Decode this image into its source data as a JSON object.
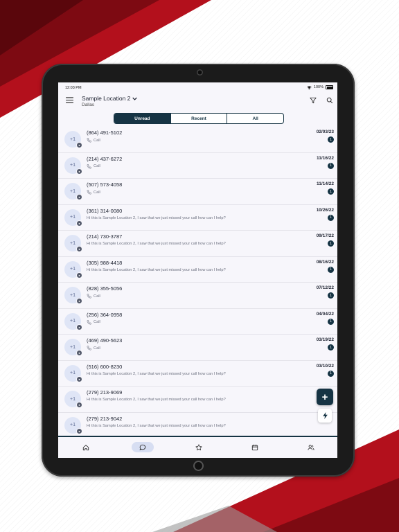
{
  "colors": {
    "accent": "#163444",
    "avatar_bg": "#dfe5f6",
    "backdrop_red": "#a90f1c"
  },
  "status_bar": {
    "time": "12:03 PM",
    "battery": "100%",
    "icons": [
      "wifi-icon",
      "battery-icon"
    ]
  },
  "header": {
    "location_name": "Sample Location 2",
    "location_city": "Dallas",
    "icons": [
      "menu-icon",
      "chevron-down-icon",
      "filter-icon",
      "search-icon"
    ]
  },
  "tabs": [
    {
      "label": "Unread",
      "active": true
    },
    {
      "label": "Recent",
      "active": false
    },
    {
      "label": "All",
      "active": false
    }
  ],
  "conversations": [
    {
      "avatar": "+1",
      "phone": "(864) 491-5102",
      "preview": "Call",
      "type": "call",
      "date": "02/03/23",
      "unread": "1"
    },
    {
      "avatar": "+1",
      "phone": "(214) 437-6272",
      "preview": "Call",
      "type": "call",
      "date": "11/16/22",
      "unread": "1"
    },
    {
      "avatar": "+1",
      "phone": "(507) 573-4058",
      "preview": "Call",
      "type": "call",
      "date": "11/14/22",
      "unread": "1"
    },
    {
      "avatar": "+1",
      "phone": "(361) 314-0080",
      "preview": "Hi this is Sample Location 2, I saw that we just missed your call how can I help?",
      "type": "text",
      "date": "10/26/22",
      "unread": "1"
    },
    {
      "avatar": "+1",
      "phone": "(214) 730-3787",
      "preview": "Hi this is Sample Location 2, I saw that we just missed your call how can I help?",
      "type": "text",
      "date": "09/17/22",
      "unread": "1"
    },
    {
      "avatar": "+1",
      "phone": "(305) 988-4418",
      "preview": "Hi this is Sample Location 2, I saw that we just missed your call how can I help?",
      "type": "text",
      "date": "08/16/22",
      "unread": "1"
    },
    {
      "avatar": "+1",
      "phone": "(828) 355-5056",
      "preview": "Call",
      "type": "call",
      "date": "07/12/22",
      "unread": "1"
    },
    {
      "avatar": "+1",
      "phone": "(256) 364-0958",
      "preview": "Call",
      "type": "call",
      "date": "04/04/22",
      "unread": "1"
    },
    {
      "avatar": "+1",
      "phone": "(469) 490-5623",
      "preview": "Call",
      "type": "call",
      "date": "03/19/22",
      "unread": "1"
    },
    {
      "avatar": "+1",
      "phone": "(516) 600-8230",
      "preview": "Hi this is Sample Location 2, I saw that we just missed your call how can I help?",
      "type": "text",
      "date": "03/10/22",
      "unread": "1"
    },
    {
      "avatar": "+1",
      "phone": "(279) 213-9069",
      "preview": "Hi this is Sample Location 2, I saw that we just missed your call how can I help?",
      "type": "text",
      "date": "",
      "unread": ""
    },
    {
      "avatar": "+1",
      "phone": "(279) 213-9042",
      "preview": "Hi this is Sample Location 2, I saw that we just missed your call how can I help?",
      "type": "text",
      "date": "",
      "unread": ""
    }
  ],
  "fab": {
    "add_label": "+",
    "bolt_icon": "bolt-icon"
  },
  "bottom_nav": [
    {
      "icon": "home-icon",
      "active": false
    },
    {
      "icon": "chat-icon",
      "active": true
    },
    {
      "icon": "star-icon",
      "active": false
    },
    {
      "icon": "calendar-icon",
      "active": false
    },
    {
      "icon": "contacts-icon",
      "active": false
    }
  ]
}
